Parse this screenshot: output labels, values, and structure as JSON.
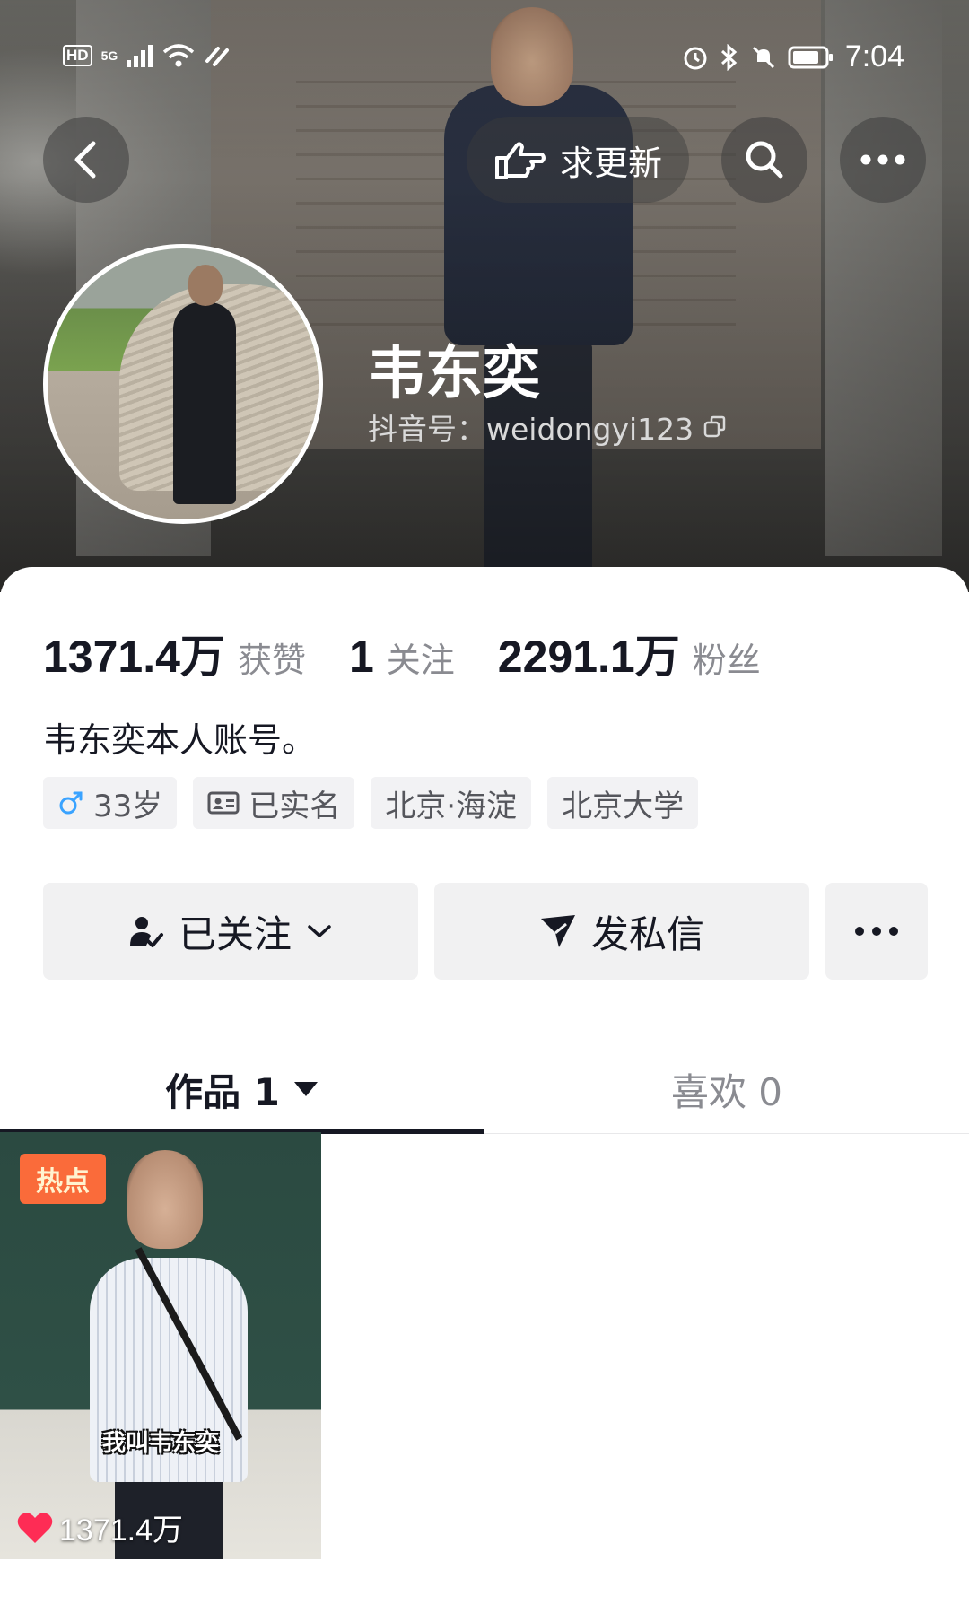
{
  "status_bar": {
    "hd_badge": "HD",
    "network": "5G",
    "time": "7:04"
  },
  "header": {
    "update_button_label": "求更新",
    "name": "韦东奕",
    "douyin_id": "抖音号：weidongyi123"
  },
  "stats": [
    {
      "value": "1371.4万",
      "label": "获赞"
    },
    {
      "value": "1",
      "label": "关注"
    },
    {
      "value": "2291.1万",
      "label": "粉丝"
    }
  ],
  "bio": "韦东奕本人账号。",
  "tags": {
    "age": "33岁",
    "verified": "已实名",
    "location": "北京·海淀",
    "school": "北京大学"
  },
  "actions": {
    "follow_label": "已关注",
    "message_label": "发私信"
  },
  "tabs": {
    "works_label": "作品 1",
    "likes_label": "喜欢 0"
  },
  "video": {
    "badge": "热点",
    "caption": "我叫韦东奕",
    "like_count": "1371.4万"
  },
  "colors": {
    "accent_red": "#fe2c55",
    "hot_badge": "#fa6b3a",
    "male_blue": "#3aa3ff"
  },
  "icons": [
    "back-icon",
    "pointing-hand-icon",
    "search-icon",
    "more-icon",
    "copy-icon",
    "male-icon",
    "id-card-icon",
    "user-check-icon",
    "chevron-down-icon",
    "send-icon",
    "caret-down-icon",
    "heart-icon"
  ]
}
